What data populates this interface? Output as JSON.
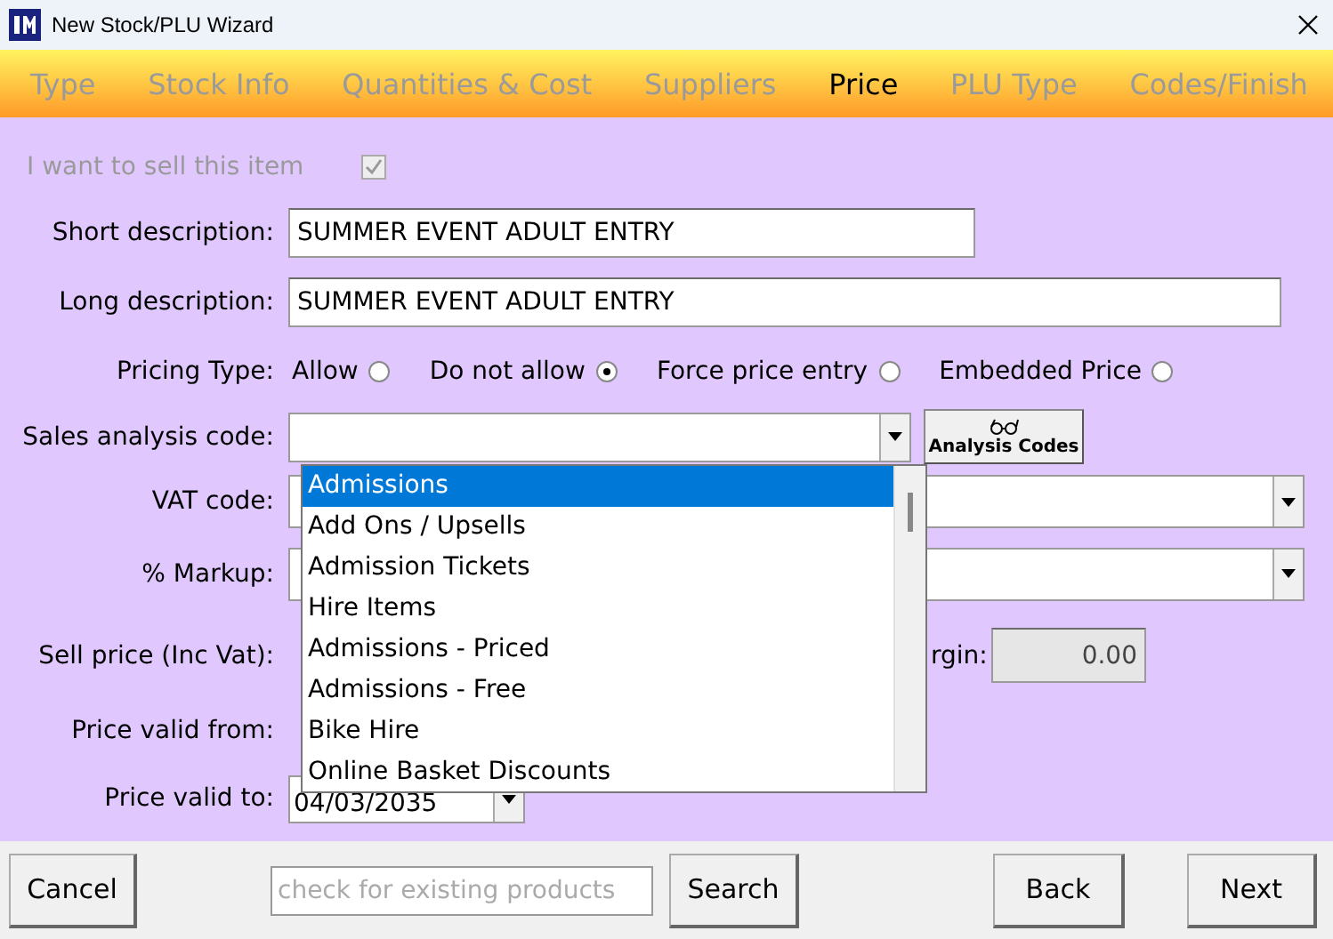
{
  "window": {
    "title": "New Stock/PLU Wizard"
  },
  "tabs": [
    {
      "label": "Type",
      "selected": false
    },
    {
      "label": "Stock Info",
      "selected": false
    },
    {
      "label": "Quantities & Cost",
      "selected": false
    },
    {
      "label": "Suppliers",
      "selected": false
    },
    {
      "label": "Price",
      "selected": true
    },
    {
      "label": "PLU Type",
      "selected": false
    },
    {
      "label": "Codes/Finish",
      "selected": false
    }
  ],
  "sell_item": {
    "label": "I want to sell this item",
    "checked": true,
    "disabled": true
  },
  "short_description": {
    "label": "Short description:",
    "value": "SUMMER EVENT ADULT ENTRY"
  },
  "long_description": {
    "label": "Long description:",
    "value": "SUMMER EVENT ADULT ENTRY"
  },
  "pricing_type": {
    "label": "Pricing Type:",
    "options": [
      {
        "label": "Allow",
        "selected": false
      },
      {
        "label": "Do not allow",
        "selected": true
      },
      {
        "label": "Force price entry",
        "selected": false
      },
      {
        "label": "Embedded Price",
        "selected": false
      }
    ]
  },
  "sales_analysis_code": {
    "label": "Sales analysis code:",
    "button": "Analysis Codes",
    "options": [
      {
        "label": "Admissions",
        "selected": true
      },
      {
        "label": "Add Ons / Upsells",
        "selected": false
      },
      {
        "label": "Admission Tickets",
        "selected": false
      },
      {
        "label": "Hire Items",
        "selected": false
      },
      {
        "label": "Admissions - Priced",
        "selected": false
      },
      {
        "label": "Admissions - Free",
        "selected": false
      },
      {
        "label": "Bike Hire",
        "selected": false
      },
      {
        "label": "Online Basket Discounts",
        "selected": false
      }
    ]
  },
  "vat_code": {
    "label": "VAT code:"
  },
  "markup": {
    "label": "% Markup:"
  },
  "sell_price": {
    "label": "Sell price (Inc Vat):"
  },
  "margin": {
    "label": "rgin:",
    "value": "0.00"
  },
  "price_valid_from": {
    "label": "Price valid from:"
  },
  "price_valid_to": {
    "label": "Price valid to:",
    "value": "04/03/2035"
  },
  "footer": {
    "cancel": "Cancel",
    "search_placeholder": "check for existing products",
    "search": "Search",
    "back": "Back",
    "next": "Next"
  }
}
